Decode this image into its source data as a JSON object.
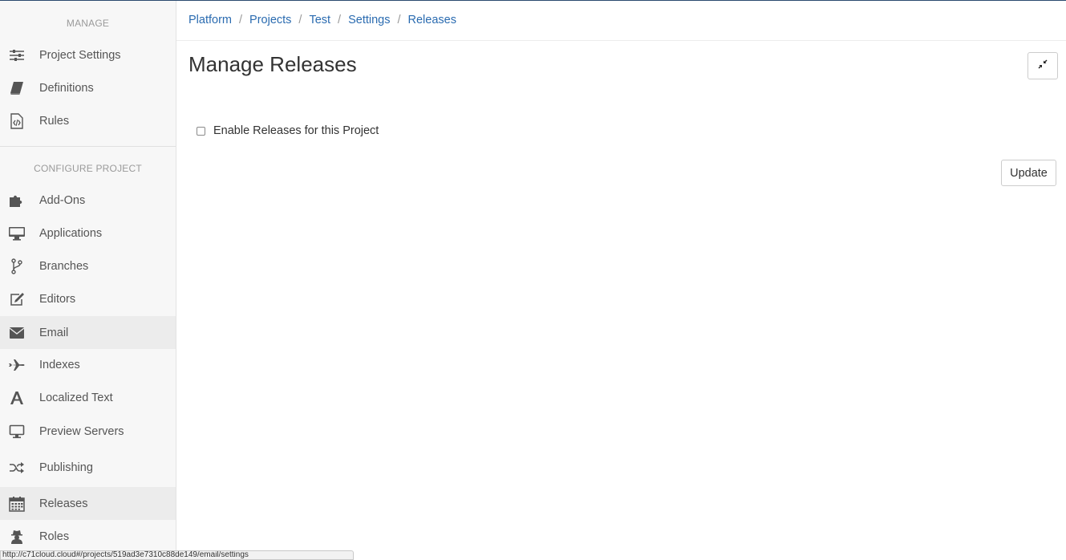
{
  "breadcrumb": [
    "Platform",
    "Projects",
    "Test",
    "Settings",
    "Releases"
  ],
  "sidebar": {
    "manage_title": "MANAGE",
    "manage_items": [
      {
        "label": "Project Settings",
        "icon": "sliders-icon"
      },
      {
        "label": "Definitions",
        "icon": "book-icon"
      },
      {
        "label": "Rules",
        "icon": "code-file-icon"
      }
    ],
    "configure_title": "CONFIGURE PROJECT",
    "configure_items": [
      {
        "label": "Add-Ons",
        "icon": "puzzle-icon"
      },
      {
        "label": "Applications",
        "icon": "desktop-icon"
      },
      {
        "label": "Branches",
        "icon": "branch-icon"
      },
      {
        "label": "Editors",
        "icon": "edit-icon"
      },
      {
        "label": "Email",
        "icon": "envelope-icon"
      },
      {
        "label": "Indexes",
        "icon": "plane-icon"
      },
      {
        "label": "Localized Text",
        "icon": "font-icon"
      },
      {
        "label": "Preview Servers",
        "icon": "monitor-icon"
      },
      {
        "label": "Publishing",
        "icon": "shuffle-icon"
      },
      {
        "label": "Releases",
        "icon": "calendar-icon"
      },
      {
        "label": "Roles",
        "icon": "user-secret-icon"
      }
    ]
  },
  "main": {
    "title": "Manage Releases",
    "enable_label": "Enable Releases for this Project",
    "enable_checked": false,
    "update_label": "Update"
  },
  "status_bar": {
    "url": "http://c71cloud.cloud#/projects/519ad3e7310c88de149/email/settings"
  },
  "colors": {
    "link": "#2a6bb0",
    "sidebar_bg": "#f7f7f7",
    "active_bg": "#ececec",
    "icon": "#555555"
  }
}
